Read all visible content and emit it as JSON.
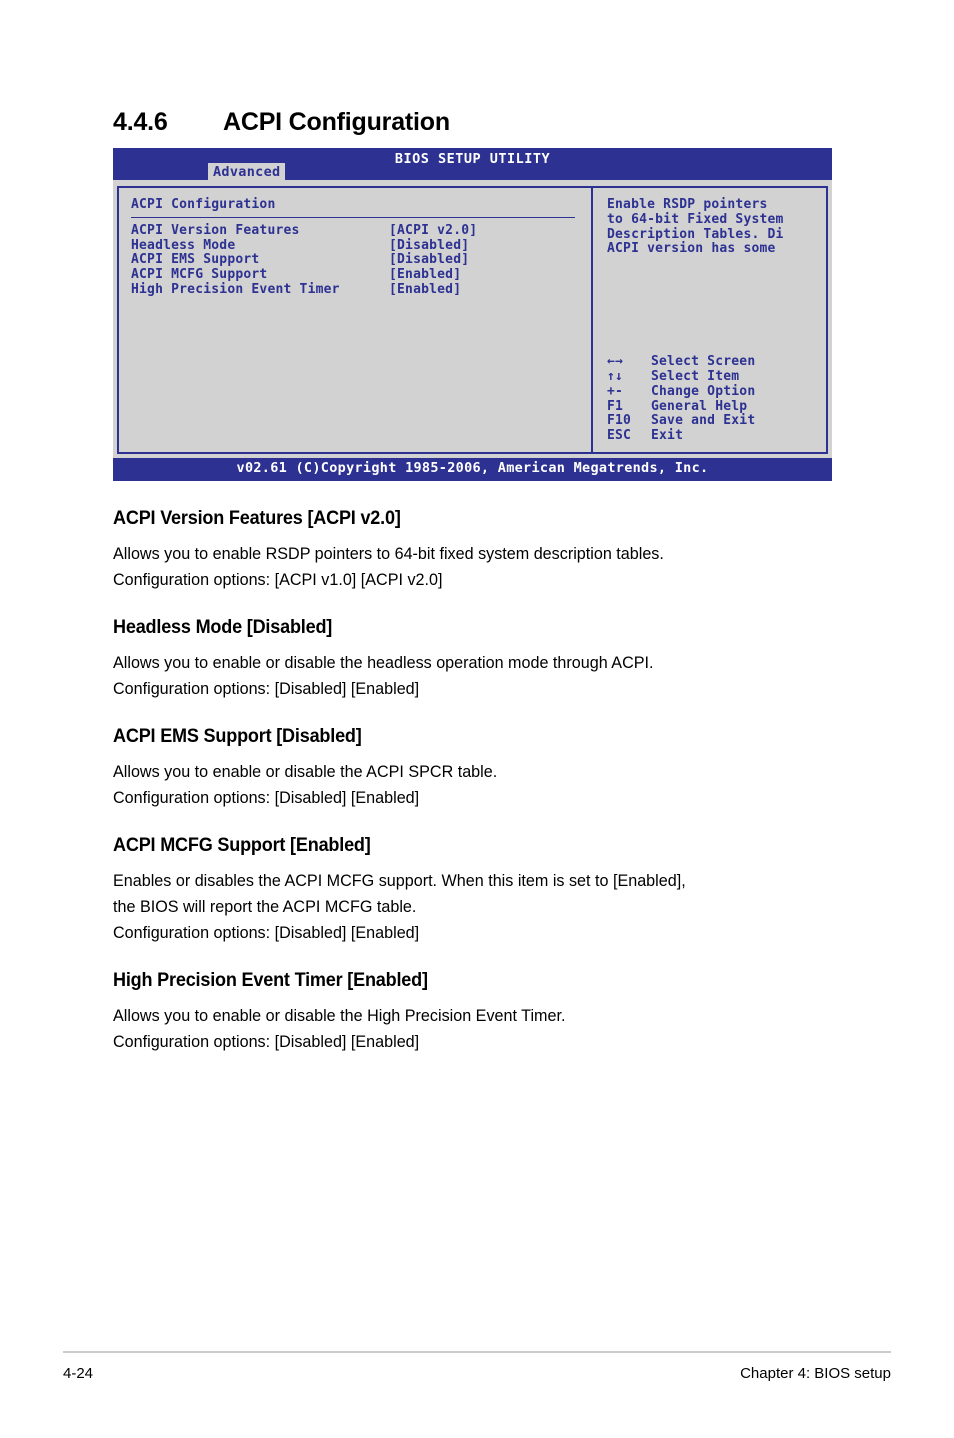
{
  "section": {
    "number": "4.4.6",
    "title": "ACPI Configuration"
  },
  "bios": {
    "title": "BIOS SETUP UTILITY",
    "active_tab": "Advanced",
    "panel_title": "ACPI Configuration",
    "options": [
      {
        "label": "ACPI Version Features",
        "value": "[ACPI v2.0]"
      },
      {
        "label": "Headless Mode",
        "value": "[Disabled]"
      },
      {
        "label": "ACPI EMS Support",
        "value": "[Disabled]"
      },
      {
        "label": "ACPI MCFG Support",
        "value": "[Enabled]"
      },
      {
        "label": "High Precision Event Timer",
        "value": "[Enabled]"
      }
    ],
    "help_lines": [
      "Enable RSDP pointers",
      "to 64-bit Fixed System",
      "Description Tables. Di",
      "ACPI version has some"
    ],
    "nav": [
      {
        "key": "←→",
        "desc": "Select Screen"
      },
      {
        "key": "↑↓",
        "desc": "Select Item"
      },
      {
        "key": "+-",
        "desc": "Change Option"
      },
      {
        "key": "F1",
        "desc": "General Help"
      },
      {
        "key": "F10",
        "desc": "Save and Exit"
      },
      {
        "key": "ESC",
        "desc": "Exit"
      }
    ],
    "footer": "v02.61 (C)Copyright 1985-2006, American Megatrends, Inc.",
    "colors": {
      "chrome_blue": "#2d3191",
      "panel_gray": "#d2d2d2",
      "text_blue": "#2d3191",
      "header_text": "#ffffff"
    }
  },
  "items": [
    {
      "heading": "ACPI Version Features [ACPI v2.0]",
      "lines": [
        "Allows you to enable RSDP pointers to 64-bit fixed system description tables.",
        "Configuration options: [ACPI v1.0] [ACPI v2.0]"
      ]
    },
    {
      "heading": "Headless Mode [Disabled]",
      "lines": [
        "Allows you to enable or disable the headless operation mode through ACPI.",
        "Configuration options: [Disabled] [Enabled]"
      ]
    },
    {
      "heading": "ACPI EMS Support [Disabled]",
      "lines": [
        "Allows you to enable or disable the ACPI SPCR table.",
        "Configuration options: [Disabled] [Enabled]"
      ]
    },
    {
      "heading": "ACPI MCFG Support [Enabled]",
      "lines": [
        "Enables or disables the ACPI MCFG support. When this item is set to [Enabled],",
        "the BIOS will report the ACPI MCFG table.",
        "Configuration options: [Disabled] [Enabled]"
      ]
    },
    {
      "heading": "High Precision Event Timer [Enabled]",
      "lines": [
        "Allows you to enable or disable the High Precision Event Timer.",
        "Configuration options: [Disabled] [Enabled]"
      ]
    }
  ],
  "page_footer": {
    "page_number": "4-24",
    "chapter": "Chapter 4: BIOS setup"
  }
}
